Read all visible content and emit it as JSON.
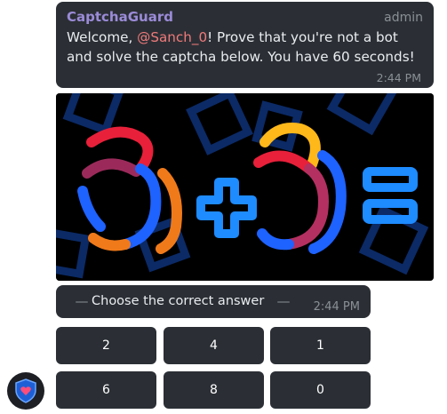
{
  "message": {
    "sender": "CaptchaGuard",
    "role": "admin",
    "text_before": "Welcome, ",
    "mention": "@Sanch_0",
    "text_line1_after": "! Prove that you're not a bot",
    "text_line2": "and solve the captcha below. You have 60 seconds!",
    "time": "2:44 PM"
  },
  "captcha": {
    "expression": "3+3=",
    "icon": "captcha-math-image"
  },
  "prompt": {
    "text": "Choose the correct answer",
    "time": "2:44 PM"
  },
  "answers": [
    {
      "label": "2"
    },
    {
      "label": "4"
    },
    {
      "label": "1"
    },
    {
      "label": "6"
    },
    {
      "label": "8"
    },
    {
      "label": "0"
    }
  ],
  "avatar": {
    "icon": "shield-heart-icon"
  },
  "colors": {
    "bubble": "#2b2f35",
    "sender": "#9b8bd8",
    "mention": "#ef7a7a",
    "captcha_blue": "#1e8bff",
    "captcha_red": "#e8203a",
    "captcha_orange": "#f07a1a"
  }
}
